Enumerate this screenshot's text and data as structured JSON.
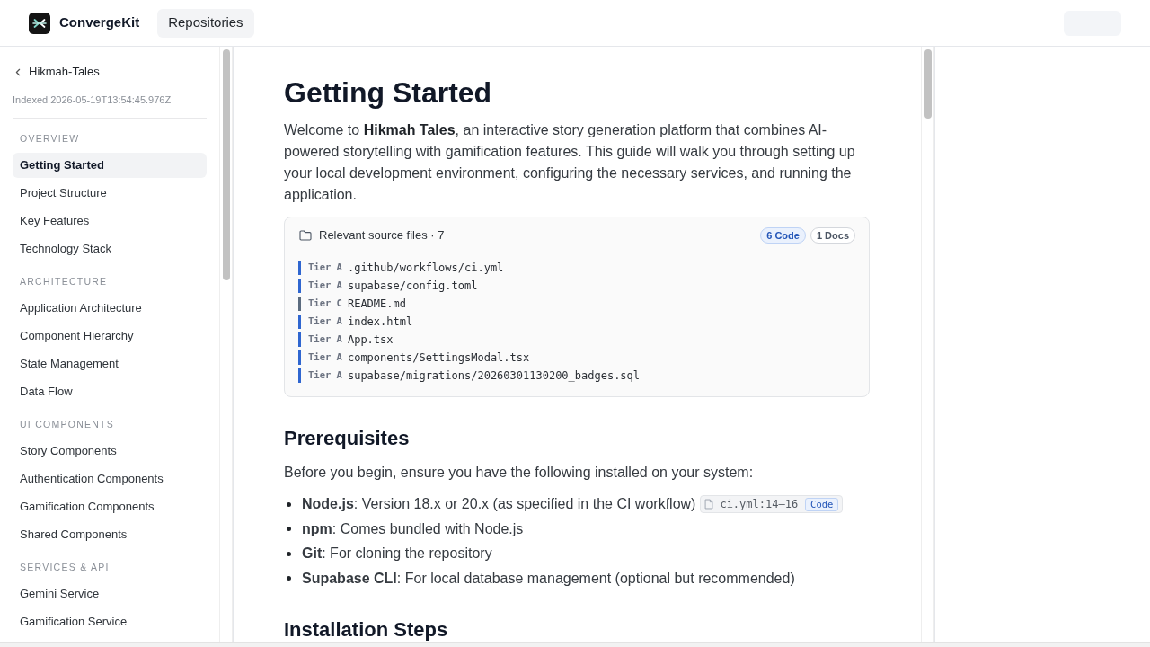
{
  "header": {
    "app_name": "ConvergeKit",
    "nav_button": "Repositories"
  },
  "sidebar": {
    "back_link": "Hikmah-Tales",
    "indexed": "Indexed 2026-05-19T13:54:45.976Z",
    "sections": [
      {
        "title": "OVERVIEW",
        "items": [
          {
            "label": "Getting Started",
            "selected": true
          },
          {
            "label": "Project Structure",
            "selected": false
          },
          {
            "label": "Key Features",
            "selected": false
          },
          {
            "label": "Technology Stack",
            "selected": false
          }
        ]
      },
      {
        "title": "ARCHITECTURE",
        "items": [
          {
            "label": "Application Architecture",
            "selected": false
          },
          {
            "label": "Component Hierarchy",
            "selected": false
          },
          {
            "label": "State Management",
            "selected": false
          },
          {
            "label": "Data Flow",
            "selected": false
          }
        ]
      },
      {
        "title": "UI COMPONENTS",
        "items": [
          {
            "label": "Story Components",
            "selected": false
          },
          {
            "label": "Authentication Components",
            "selected": false
          },
          {
            "label": "Gamification Components",
            "selected": false
          },
          {
            "label": "Shared Components",
            "selected": false
          }
        ]
      },
      {
        "title": "SERVICES & API",
        "items": [
          {
            "label": "Gemini Service",
            "selected": false
          },
          {
            "label": "Gamification Service",
            "selected": false
          }
        ]
      }
    ]
  },
  "article": {
    "title": "Getting Started",
    "intro": "Welcome to **Hikmah Tales**, an interactive story generation platform that combines AI-powered storytelling with gamification features. This guide will walk you through setting up your local development environment, configuring the necessary services, and running the application.",
    "source_files": {
      "title": "Relevant source files · 7",
      "badges": [
        {
          "label": "6 Code",
          "kind": "code"
        },
        {
          "label": "1 Docs",
          "kind": "docs"
        }
      ],
      "files": [
        {
          "tier": "Tier A",
          "path": ".github/workflows/ci.yml",
          "color": "#2f66d0"
        },
        {
          "tier": "Tier A",
          "path": "supabase/config.toml",
          "color": "#2f66d0"
        },
        {
          "tier": "Tier C",
          "path": "README.md",
          "color": "#5b6b7e"
        },
        {
          "tier": "Tier A",
          "path": "index.html",
          "color": "#2f66d0"
        },
        {
          "tier": "Tier A",
          "path": "App.tsx",
          "color": "#2f66d0"
        },
        {
          "tier": "Tier A",
          "path": "components/SettingsModal.tsx",
          "color": "#2f66d0"
        },
        {
          "tier": "Tier A",
          "path": "supabase/migrations/20260301130200_badges.sql",
          "color": "#2f66d0"
        }
      ]
    },
    "sections": [
      {
        "heading": "Prerequisites",
        "text": "Before you begin, ensure you have the following installed on your system:",
        "items": [
          {
            "text": "**Node.js**: Version 18.x or 20.x (as specified in the CI workflow)",
            "citation": {
              "label": "ci.yml:14–16",
              "badge": {
                "label": "Code",
                "kind": "code"
              }
            }
          },
          {
            "text": "**npm**: Comes bundled with Node.js"
          },
          {
            "text": "**Git**: For cloning the repository"
          },
          {
            "text": "**Supabase CLI**: For local database management (optional but recommended)"
          }
        ]
      },
      {
        "heading": "Installation Steps"
      }
    ]
  }
}
